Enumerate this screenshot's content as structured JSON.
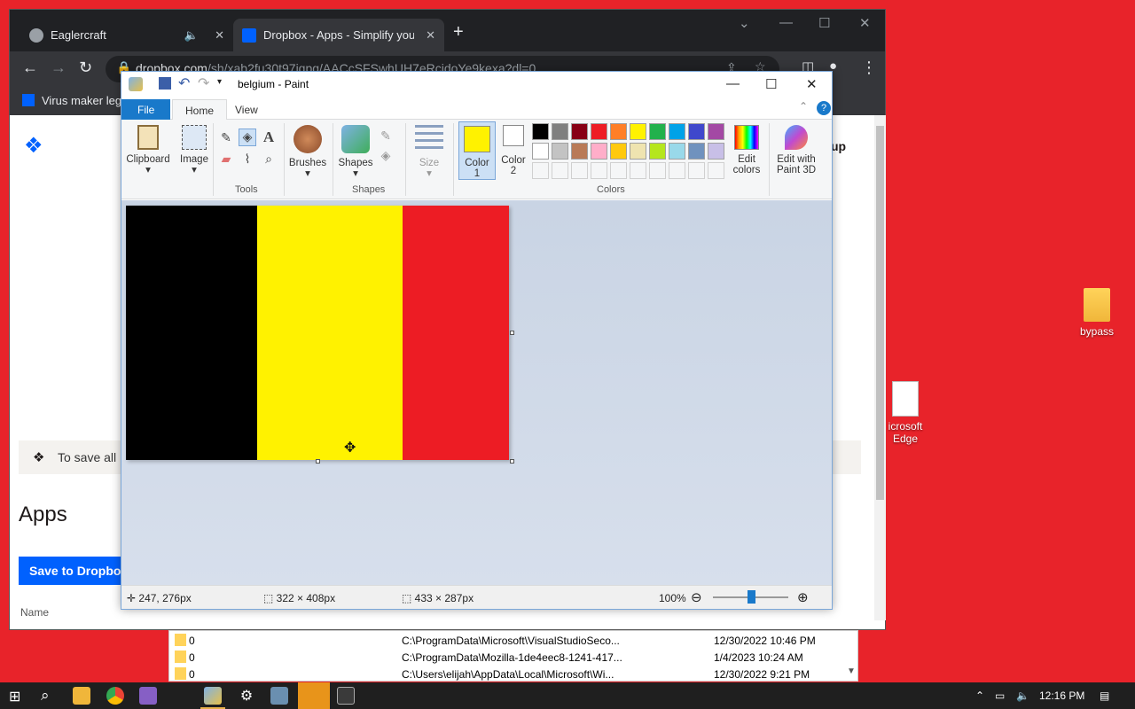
{
  "desktop": {
    "icons": [
      {
        "label": "bypass",
        "icon": "folder-icon"
      },
      {
        "label": "icrosoft\nEdge",
        "icon": "edge-file-icon"
      }
    ]
  },
  "browser": {
    "tabs": [
      {
        "title": "Eaglercraft",
        "icon": "globe-icon",
        "audio": true,
        "close": "✕"
      },
      {
        "title": "Dropbox - Apps - Simplify your li",
        "icon": "dropbox-icon",
        "close": "✕",
        "active": true
      }
    ],
    "new_tab": "+",
    "url_domain": "dropbox.com",
    "url_path": "/sh/xab2fu30t97iqpg/AACcSFSwhUH7eRcjdoYe9kexa?dl=0",
    "bookmark": "Virus maker legi",
    "page": {
      "header_right": "up",
      "banner_text": "To save all",
      "apps_heading": "Apps",
      "save_button": "Save to Dropbo",
      "name_column": "Name"
    }
  },
  "paint": {
    "title": "belgium - Paint",
    "tabs": {
      "file": "File",
      "home": "Home",
      "view": "View"
    },
    "ribbon": {
      "clipboard": "Clipboard",
      "image": "Image",
      "tools_group": "Tools",
      "brushes": "Brushes",
      "shapes": "Shapes",
      "shapes_group": "Shapes",
      "size": "Size",
      "color1": "Color\n1",
      "color2": "Color\n2",
      "edit_colors": "Edit\ncolors",
      "edit_paint3d": "Edit with\nPaint 3D",
      "colors_group": "Colors"
    },
    "color1": "#fff200",
    "color2": "#ffffff",
    "palette_row1": [
      "#000000",
      "#7f7f7f",
      "#880015",
      "#ed1c24",
      "#ff7f27",
      "#fff200",
      "#22b14c",
      "#00a2e8",
      "#3f48cc",
      "#a349a4"
    ],
    "palette_row2": [
      "#ffffff",
      "#c3c3c3",
      "#b97a57",
      "#ffaec9",
      "#ffc90e",
      "#efe4b0",
      "#b5e61d",
      "#99d9ea",
      "#7092be",
      "#c8bfe7"
    ],
    "flag_colors": [
      "#000000",
      "#fff200",
      "#ed1c24"
    ],
    "status": {
      "cursor_pos": "247, 276px",
      "selection_size": "322 × 408px",
      "image_size": "433 × 287px",
      "zoom": "100%"
    }
  },
  "explorer": {
    "rows": [
      {
        "name": "0",
        "path": "C:\\ProgramData\\Microsoft\\VisualStudioSeco...",
        "date": "12/30/2022 10:46 PM"
      },
      {
        "name": "0",
        "path": "C:\\ProgramData\\Mozilla-1de4eec8-1241-417...",
        "date": "1/4/2023 10:24 AM"
      },
      {
        "name": "0",
        "path": "C:\\Users\\elijah\\AppData\\Local\\Microsoft\\Wi...",
        "date": "12/30/2022 9:21 PM"
      }
    ]
  },
  "taskbar": {
    "time": "12:16 PM"
  }
}
